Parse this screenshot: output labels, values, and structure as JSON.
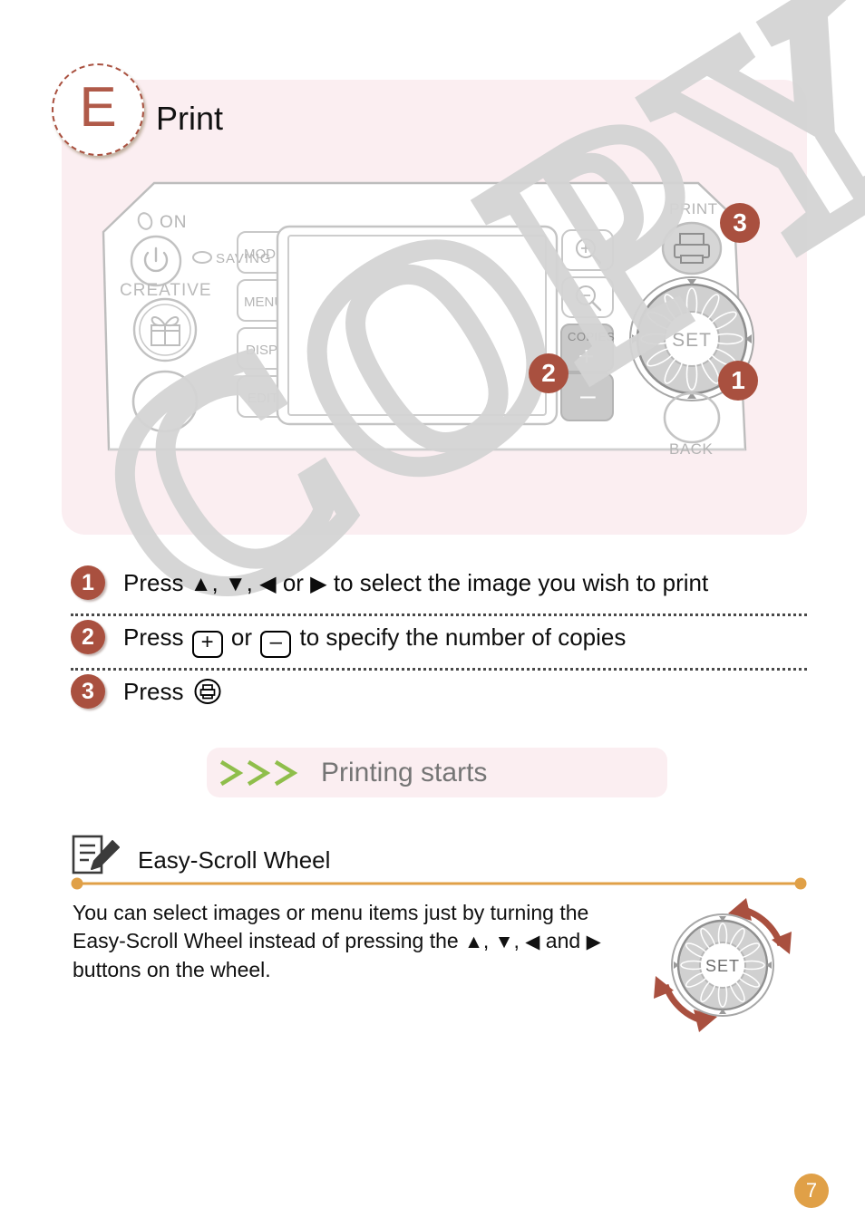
{
  "header": {
    "badge_letter": "E",
    "title": "Print"
  },
  "diagram": {
    "callouts": [
      {
        "id": "3",
        "target": "print-button"
      },
      {
        "id": "2",
        "target": "copies-buttons"
      },
      {
        "id": "1",
        "target": "easy-scroll-wheel"
      }
    ],
    "labels": {
      "on": "ON",
      "saving": "SAVING",
      "creative": "CREATIVE",
      "mode": "MODE",
      "menu": "MENU",
      "disp": "DISP.",
      "edit": "EDIT",
      "copies": "COPIES",
      "plus": "+",
      "minus": "–",
      "print": "PRINT",
      "set": "SET",
      "back": "BACK"
    }
  },
  "steps": [
    {
      "number": "1",
      "prefix": "Press ",
      "glyph_up": "▲",
      "sep1": ", ",
      "glyph_down": "▼",
      "sep2": ", ",
      "glyph_left": "◀",
      "sep3": " or ",
      "glyph_right": "▶",
      "suffix": " to select the image you wish to print"
    },
    {
      "number": "2",
      "prefix": "Press ",
      "glyph_plus": "+",
      "sep1": " or ",
      "glyph_minus": "–",
      "suffix": " to specify the number of copies"
    },
    {
      "number": "3",
      "prefix": "Press ",
      "glyph_print": "print-icon"
    }
  ],
  "banner": {
    "chevrons": "› › ›",
    "label": "Printing starts",
    "chevron_color": "#8fbe4b",
    "background": "#fbeef1"
  },
  "tip": {
    "icon": "note-pencil-icon",
    "title": "Easy-Scroll Wheel",
    "divider_color": "#e0a047",
    "body_line1": "You can select images or menu items just by turning the",
    "body_line2_a": "Easy-Scroll Wheel instead of pressing the ",
    "body_glyph_up": "▲",
    "body_sep1": ", ",
    "body_glyph_down": "▼",
    "body_sep2": ", ",
    "body_glyph_left": "◀",
    "body_sep3": " and ",
    "body_glyph_right": "▶",
    "body_line3": "buttons on the wheel.",
    "wheel_label": "SET"
  },
  "footer": {
    "page_number": "7"
  },
  "watermark": {
    "text": "COPY"
  },
  "colors": {
    "accent_red": "#a9503f",
    "panel_pink": "#fbeef1",
    "orange": "#e0a047",
    "green": "#8fbe4b",
    "diagram_gray": "#bcbcbc"
  }
}
